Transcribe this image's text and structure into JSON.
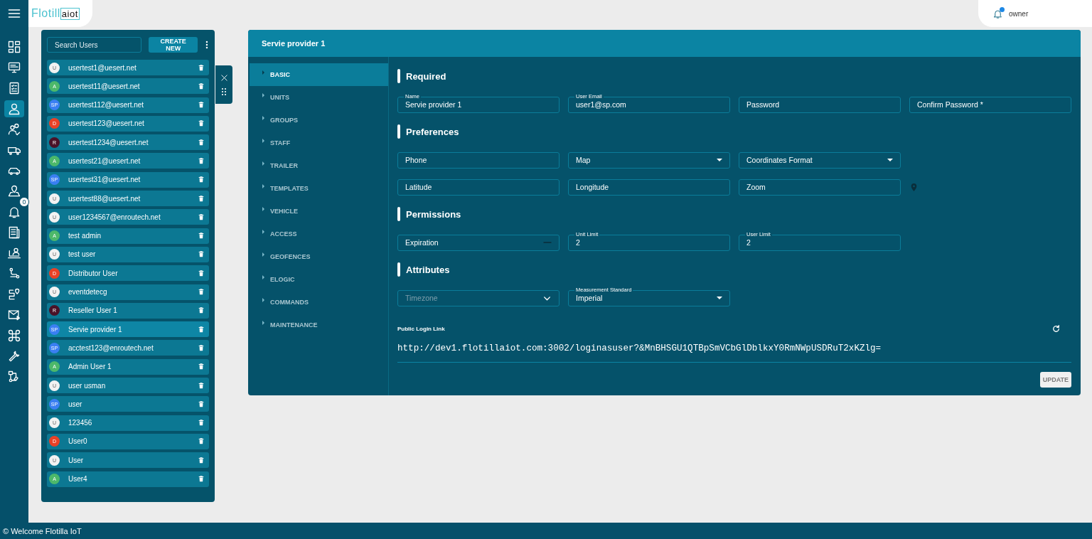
{
  "header": {
    "logo_text": "Flotill",
    "logo_suffix": "aiot",
    "user": {
      "name": "owner",
      "notification_dot": true
    }
  },
  "sidebar": {
    "items": [
      {
        "selected": false
      },
      {
        "selected": false
      },
      {
        "selected": false
      },
      {
        "selected": true
      },
      {
        "selected": false
      },
      {
        "selected": false
      },
      {
        "selected": false
      },
      {
        "selected": false
      },
      {
        "selected": false,
        "badge": "0"
      },
      {
        "selected": false
      },
      {
        "selected": false
      },
      {
        "selected": false
      },
      {
        "selected": false
      },
      {
        "selected": false
      },
      {
        "selected": false
      },
      {
        "selected": false
      },
      {
        "selected": false
      }
    ]
  },
  "users_panel": {
    "search": {
      "placeholder": "Search Users"
    },
    "create_button": "CREATE NEW",
    "users": [
      {
        "initials": "U",
        "color": "#f2f2f2",
        "name": "usertest1@uesert.net",
        "selected": false
      },
      {
        "initials": "A",
        "color": "#4cb86a",
        "name": "usertest11@uesert.net",
        "selected": false
      },
      {
        "initials": "SP",
        "color": "#3a7ff2",
        "name": "usertest112@uesert.net",
        "selected": false
      },
      {
        "initials": "D",
        "color": "#ea4126",
        "name": "usertest123@uesert.net",
        "selected": false
      },
      {
        "initials": "R",
        "color": "#4a1228",
        "name": "usertest1234@uesert.net",
        "selected": false
      },
      {
        "initials": "A",
        "color": "#4cb86a",
        "name": "usertest21@uesert.net",
        "selected": false
      },
      {
        "initials": "SP",
        "color": "#3a7ff2",
        "name": "usertest31@uesert.net",
        "selected": false
      },
      {
        "initials": "U",
        "color": "#f2f2f2",
        "name": "usertest88@uesert.net",
        "selected": false
      },
      {
        "initials": "U",
        "color": "#f2f2f2",
        "name": "user1234567@enroutech.net",
        "selected": false
      },
      {
        "initials": "A",
        "color": "#4cb86a",
        "name": "test admin",
        "selected": false
      },
      {
        "initials": "U",
        "color": "#f2f2f2",
        "name": "test user",
        "selected": false
      },
      {
        "initials": "D",
        "color": "#ea4126",
        "name": "Distributor User",
        "selected": false
      },
      {
        "initials": "U",
        "color": "#f2f2f2",
        "name": "eventdetecg",
        "selected": false
      },
      {
        "initials": "R",
        "color": "#4a1228",
        "name": "Reseller User 1",
        "selected": false
      },
      {
        "initials": "SP",
        "color": "#3a7ff2",
        "name": "Servie provider 1",
        "selected": true
      },
      {
        "initials": "SP",
        "color": "#3a7ff2",
        "name": "acctest123@enroutech.net",
        "selected": false
      },
      {
        "initials": "A",
        "color": "#4cb86a",
        "name": "Admin User 1",
        "selected": false
      },
      {
        "initials": "U",
        "color": "#f2f2f2",
        "name": "user usman",
        "selected": false
      },
      {
        "initials": "SP",
        "color": "#3a7ff2",
        "name": "user",
        "selected": false
      },
      {
        "initials": "U",
        "color": "#f2f2f2",
        "name": "123456",
        "selected": false
      },
      {
        "initials": "D",
        "color": "#ea4126",
        "name": "User0",
        "selected": false
      },
      {
        "initials": "U",
        "color": "#f2f2f2",
        "name": "User",
        "selected": false
      },
      {
        "initials": "A",
        "color": "#4cb86a",
        "name": "User4",
        "selected": false
      }
    ]
  },
  "profile": {
    "title": "Servie provider 1",
    "nav": [
      {
        "label": "BASIC",
        "selected": true
      },
      {
        "label": "UNITS",
        "selected": false
      },
      {
        "label": "GROUPS",
        "selected": false
      },
      {
        "label": "STAFF",
        "selected": false
      },
      {
        "label": "TRAILER",
        "selected": false
      },
      {
        "label": "TEMPLATES",
        "selected": false
      },
      {
        "label": "VEHICLE",
        "selected": false
      },
      {
        "label": "ACCESS",
        "selected": false
      },
      {
        "label": "GEOFENCES",
        "selected": false
      },
      {
        "label": "ELOGIC",
        "selected": false
      },
      {
        "label": "COMMANDS",
        "selected": false
      },
      {
        "label": "MAINTENANCE",
        "selected": false
      }
    ],
    "sections": [
      {
        "heading": "Required",
        "rows": [
          [
            {
              "kind": "text",
              "label": "Name",
              "value": "Servie provider 1"
            },
            {
              "kind": "text",
              "label": "User Email",
              "value": "user1@sp.com"
            },
            {
              "kind": "text",
              "placeholder": "Password"
            },
            {
              "kind": "text",
              "placeholder": "Confirm Password *"
            }
          ]
        ]
      },
      {
        "heading": "Preferences",
        "rows": [
          [
            {
              "kind": "text",
              "placeholder": "Phone"
            },
            {
              "kind": "select",
              "placeholder": "Map"
            },
            {
              "kind": "select",
              "placeholder": "Coordinates Format"
            }
          ],
          [
            {
              "kind": "text",
              "placeholder": "Latitude"
            },
            {
              "kind": "text",
              "placeholder": "Longitude"
            },
            {
              "kind": "text",
              "placeholder": "Zoom"
            },
            {
              "kind": "pin"
            }
          ]
        ]
      },
      {
        "heading": "Permissions",
        "rows": [
          [
            {
              "kind": "date",
              "placeholder": "Expiration"
            },
            {
              "kind": "text",
              "label": "Unit Limit",
              "value": "2"
            },
            {
              "kind": "text",
              "label": "User Limit",
              "value": "2"
            }
          ]
        ]
      },
      {
        "heading": "Attributes",
        "rows": [
          [
            {
              "kind": "autocomplete",
              "placeholder": "Timezone",
              "disabled": true
            },
            {
              "kind": "select",
              "label": "Measurement Standard",
              "value": "Imperial"
            }
          ]
        ]
      }
    ],
    "public_link": {
      "label": "Public Login Link",
      "url": "http://dev1.flotillaiot.com:3002/loginasuser?&MnBHSGU1QTBpSmVCbGlDblkxY0RmNWpUSDRuT2xKZlg="
    },
    "update_button": {
      "label": "UPDATE",
      "disabled": true
    }
  },
  "footer": {
    "text": "© Welcome Flotilla IoT"
  }
}
